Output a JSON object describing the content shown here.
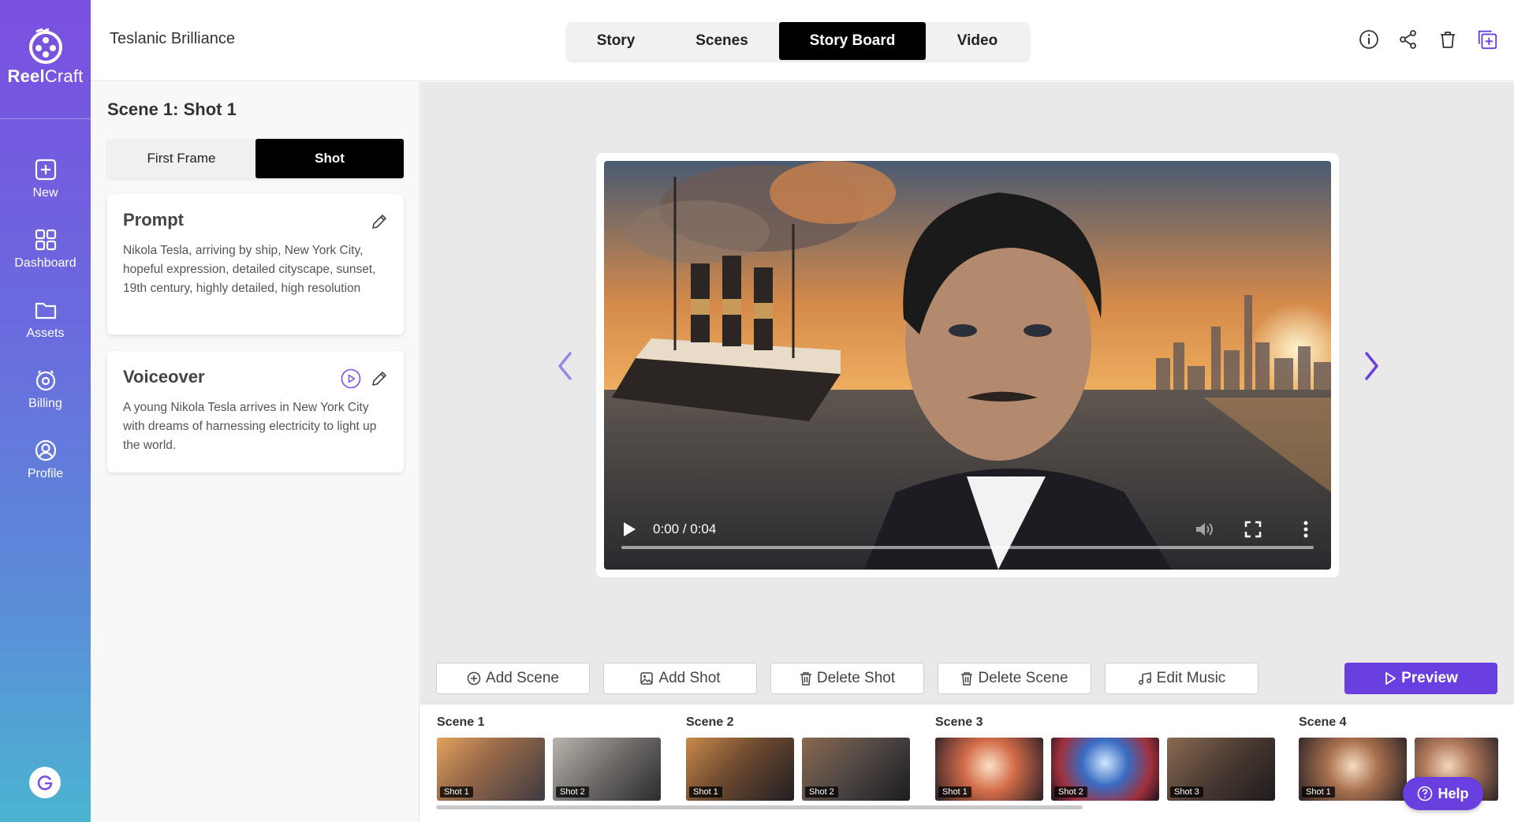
{
  "app": {
    "logo_bold": "Reel",
    "logo_light": "Craft",
    "avatar_letter": "G"
  },
  "sidebar": {
    "items": [
      {
        "label": "New",
        "icon": "plus-square-icon"
      },
      {
        "label": "Dashboard",
        "icon": "grid-icon"
      },
      {
        "label": "Assets",
        "icon": "folder-icon"
      },
      {
        "label": "Billing",
        "icon": "coin-icon"
      },
      {
        "label": "Profile",
        "icon": "user-circle-icon"
      }
    ]
  },
  "header": {
    "project_title": "Teslanic Brilliance",
    "tabs": [
      {
        "label": "Story",
        "active": false
      },
      {
        "label": "Scenes",
        "active": false
      },
      {
        "label": "Story Board",
        "active": true
      },
      {
        "label": "Video",
        "active": false
      }
    ],
    "icons": [
      "info-icon",
      "share-icon",
      "trash-icon",
      "copy-add-icon"
    ]
  },
  "panel": {
    "heading": "Scene 1: Shot 1",
    "toggle": {
      "first_frame": "First Frame",
      "shot": "Shot",
      "selected": "Shot"
    },
    "prompt": {
      "title": "Prompt",
      "text": "Nikola Tesla, arriving by ship, New York City, hopeful expression, detailed cityscape, sunset, 19th century, highly detailed, high resolution"
    },
    "voiceover": {
      "title": "Voiceover",
      "text": "A young Nikola Tesla arrives in New York City with dreams of harnessing electricity to light up the world."
    }
  },
  "player": {
    "time": "0:00 / 0:04",
    "progress": 0
  },
  "actions": {
    "add_scene": "Add Scene",
    "add_shot": "Add Shot",
    "delete_shot": "Delete Shot",
    "delete_scene": "Delete Scene",
    "edit_music": "Edit Music",
    "preview": "Preview"
  },
  "filmstrip": {
    "scenes": [
      {
        "label": "Scene 1",
        "shots": [
          "Shot 1",
          "Shot 2"
        ]
      },
      {
        "label": "Scene 2",
        "shots": [
          "Shot 1",
          "Shot 2"
        ]
      },
      {
        "label": "Scene 3",
        "shots": [
          "Shot 1",
          "Shot 2",
          "Shot 3"
        ]
      },
      {
        "label": "Scene 4",
        "shots": [
          "Shot 1",
          ""
        ]
      }
    ]
  },
  "help": {
    "label": "Help"
  },
  "colors": {
    "accent": "#6a3fe0",
    "sidebar_top": "#7b4fe0",
    "sidebar_bottom": "#4bb4d2"
  }
}
